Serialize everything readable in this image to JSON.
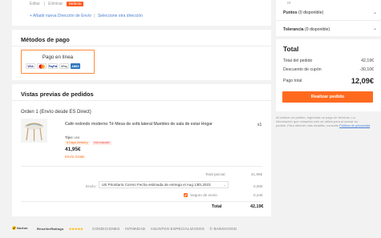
{
  "address": {
    "edit": "Editar",
    "delete": "Eliminar",
    "default_badge": "Defecto",
    "add_new": "+ Añadir nueva Dirección de Envío",
    "separator": "|",
    "select_other": "Seleccione otra dirección"
  },
  "payment": {
    "title": "Métodos de pago",
    "option_label": "Pago en línea",
    "logos": [
      "VISA",
      "MC",
      "PayPal",
      "GPay",
      "AMEX"
    ]
  },
  "preview": {
    "title": "Vistas previas de pedidos",
    "order_header": "Orden 1 (Envío desde ES Direct)",
    "product": {
      "name": "Café redondo moderno Té Mesa de sofá lateral Muebles de sala de estar Hogar",
      "type_label": "Tipo:",
      "type_value": "uno",
      "tag_delivery": "5 Days Delivery",
      "tag_vat": "IVA incluido",
      "price": "41,95€",
      "shipping_note": "Envío Gratis",
      "qty": "x1"
    },
    "subtotal_label": "Total parcial",
    "subtotal_value": "41,95€",
    "shipping_label": "Envío:",
    "shipping_value": "0,00€",
    "shipping_select": "UE Prioritario Correo Fecha estimada de entrega el Aug 13th,2023",
    "insurance_label": "Seguro de envío",
    "insurance_value": "0,24€",
    "total_label": "Total",
    "total_value": "42,19€"
  },
  "side": {
    "or_text": "or",
    "points_label": "Puntos",
    "points_note": "(0 disponible)",
    "tolerance_label": "Tolerancia",
    "tolerance_note": "(0 disponible)"
  },
  "summary": {
    "title": "Total",
    "order_total_label": "Total del pedido",
    "order_total_value": "42,19€",
    "coupon_label": "Descuento de cupón",
    "coupon_value": "-30,10€",
    "pay_total_label": "Pago total",
    "pay_total_value": "12,09€",
    "order_button": "Realizar pedido",
    "legal_text_1": "Al realizar un pedido, ingresará un pago de terceros. La",
    "legal_text_2": "información que completó solo se utiliza para procesar su",
    "legal_text_3": "pedido. Para obtener más detalles, consulte",
    "legal_link": "Política de privacidad"
  },
  "footer": {
    "norton": "Norton",
    "reseller": "ResellerRatings",
    "stars": "★★★★★",
    "links": [
      "CONDICIONES",
      "INTIMIDAD",
      "ASUNTOS ESPECIALIZADOS",
      "© BANGGOOD"
    ]
  },
  "colors": {
    "accent": "#ff6a1f",
    "link": "#4a7fd6"
  }
}
